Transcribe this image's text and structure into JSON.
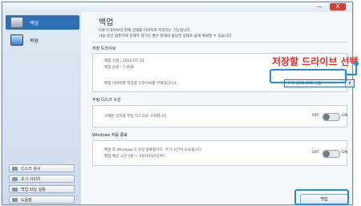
{
  "window": {
    "minimize": "—",
    "close": "X"
  },
  "sidebar": {
    "items": [
      {
        "label": "백업",
        "icon": "backup-drive-icon"
      },
      {
        "label": "복원",
        "icon": "restore-drive-icon"
      }
    ],
    "tools": [
      {
        "label": "디스크 복사",
        "icon": "disk-copy-icon"
      },
      {
        "label": "초기 이미지",
        "icon": "initial-image-icon"
      },
      {
        "label": "백업 파일 설정",
        "icon": "backup-settings-icon"
      },
      {
        "label": "도움말",
        "icon": "help-icon"
      }
    ]
  },
  "main": {
    "title": "백업",
    "desc_line1": "CW 드라이브의 현재 상태를 이미지로 저장하는 기능입니다.",
    "desc_line2": "사용 중인 컴퓨터에 문제가 생기는 경우 현재의 동일한 상태로 쉽게 복원할 수 있습니다.",
    "save_drive": {
      "heading": "저장 드라이브",
      "backup_date": "백업 시점 : 2012-07-13",
      "backup_size": "백업 용량 : 7.9GB",
      "instruction": "백업 이미지를 저장할 드라이브를 선택하십시오.",
      "selected_drive": "F:₩ (232.8GB 남음)"
    },
    "boot_disk": {
      "heading": "부팅 디스크 구성",
      "description": "선택된 장치를 부팅 디스크로 구성합니다.",
      "toggle_off": "OFF",
      "toggle_on": "ON",
      "state": "off"
    },
    "windows_shutdown": {
      "heading": "Windows 자동 종료",
      "line1": "백업 후 Windows가 정상 종료합니다. 추가 시간이 소요됩니다.",
      "line2": "백업 예상 시간 5분 ~ 2분(미리카운트)",
      "toggle_off": "OFF",
      "toggle_on": "ON",
      "state": "off"
    },
    "run_button": "백업"
  },
  "annotation": {
    "callout": "저장할 드라이브 선택",
    "highlight_color": "#1e8fd6",
    "callout_color": "#e5302a"
  }
}
